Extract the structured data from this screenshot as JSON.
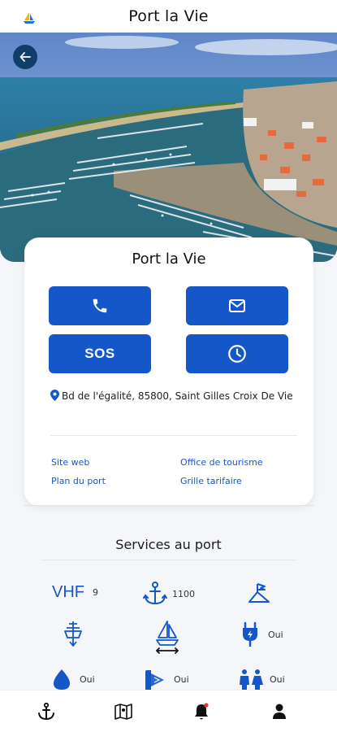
{
  "header": {
    "title": "Port la Vie",
    "logo_icon": "sailboat-logo-icon"
  },
  "hero": {
    "back_icon": "arrow-left-icon"
  },
  "card": {
    "name": "Port la Vie",
    "actions": {
      "phone_icon": "phone-icon",
      "mail_icon": "mail-icon",
      "sos_label": "SOS",
      "hours_icon": "clock-icon"
    },
    "address": "Bd de l'égalité, 85800, Saint Gilles Croix De Vie",
    "links": {
      "website": "Site web",
      "tourism": "Office de tourisme",
      "map": "Plan du port",
      "pricing": "Grille tarifaire"
    }
  },
  "services": {
    "title": "Services au port",
    "vhf_label": "VHF",
    "vhf_value": "9",
    "moorings_value": "1100",
    "electricity_value": "Oui",
    "water_value": "Oui",
    "showers_value": "Oui",
    "toilets_value": "Oui"
  },
  "colors": {
    "primary": "#1557c9",
    "back_button": "#113d6b",
    "link": "#1a56c4"
  }
}
